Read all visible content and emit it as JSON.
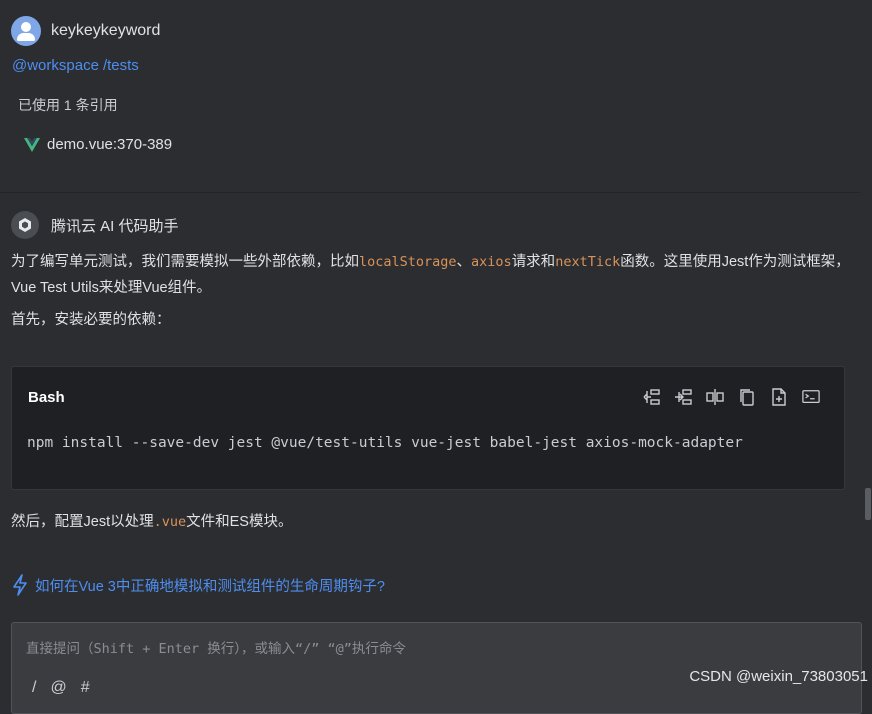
{
  "user": {
    "name": "keykeykeyword",
    "mention_workspace": "@workspace",
    "mention_path": "/tests",
    "ref_count": "已使用 1 条引用",
    "file_ref": "demo.vue:370-389"
  },
  "assistant": {
    "name": "腾讯云 AI 代码助手",
    "para1": {
      "t1": "为了编写单元测试，我们需要模拟一些外部依赖，比如",
      "c1": "localStorage",
      "t2": "、",
      "c2": "axios",
      "t3": "请求和",
      "c3": "nextTick",
      "t4": "函数。这里使用Jest作为测试框架，Vue Test Utils来处理Vue组件。"
    },
    "para2": "首先，安装必要的依赖：",
    "code_block": {
      "language": "Bash",
      "code": "npm install --save-dev jest @vue/test-utils vue-jest babel-jest axios-mock-adapter",
      "tools": [
        "insert-above-icon",
        "insert-below-icon",
        "diff-icon",
        "copy-icon",
        "new-file-icon",
        "terminal-icon"
      ]
    },
    "para3": {
      "t1": "然后，配置Jest以处理",
      "c1": ".vue",
      "t2": "文件和ES模块。"
    }
  },
  "suggestion": "如何在Vue 3中正确地模拟和测试组件的生命周期钩子?",
  "input": {
    "placeholder": "直接提问（Shift + Enter 换行），或输入“/” “@”执行命令",
    "tools": [
      "/",
      "@",
      "#"
    ]
  },
  "watermark": "CSDN @weixin_73803051",
  "colors": {
    "link": "#4e8ef0",
    "inline_code": "#d9925a",
    "background": "#2b2d30",
    "vue_green": "#41b883"
  }
}
